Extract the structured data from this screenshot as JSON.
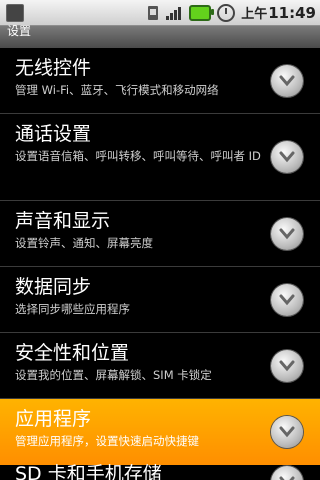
{
  "status_bar": {
    "time_ampm": "上午",
    "time": "11:49",
    "icons": [
      "usb-icon",
      "signal-icon",
      "battery-icon",
      "alarm-clock-icon"
    ]
  },
  "app_title": "设置",
  "settings": [
    {
      "title": "无线控件",
      "summary": "管理 Wi-Fi、蓝牙、飞行模式和移动网络"
    },
    {
      "title": "通话设置",
      "summary": "设置语音信箱、呼叫转移、呼叫等待、呼叫者 ID"
    },
    {
      "title": "声音和显示",
      "summary": "设置铃声、通知、屏幕亮度"
    },
    {
      "title": "数据同步",
      "summary": "选择同步哪些应用程序"
    },
    {
      "title": "安全性和位置",
      "summary": "设置我的位置、屏幕解锁、SIM 卡锁定"
    },
    {
      "title": "应用程序",
      "summary": "管理应用程序，设置快速启动快捷键"
    },
    {
      "title": "SD 卡和手机存储"
    }
  ],
  "selected_item": "应用程序",
  "colors": {
    "background": "#000000",
    "highlight": "#ff9800",
    "summary_text": "#cfcfcf",
    "title_text": "#ffffff"
  }
}
